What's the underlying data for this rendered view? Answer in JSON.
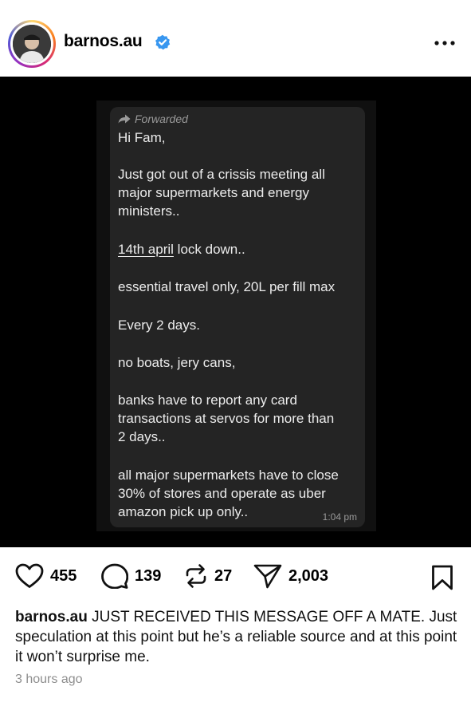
{
  "header": {
    "username": "barnos.au",
    "verified": true,
    "more_icon": "more-horizontal-icon",
    "avatar_ring_colors": [
      "#feda75",
      "#fa7e1e",
      "#d62976",
      "#962fbf",
      "#4f5bd5"
    ]
  },
  "message": {
    "forwarded_label": "Forwarded",
    "lines": [
      "Hi Fam,",
      "",
      "Just got out of a crissis meeting all",
      "major supermarkets and energy",
      "ministers..",
      "",
      "14th april lock down..",
      "",
      "essential travel only, 20L per fill max",
      "",
      "Every 2 days.",
      "",
      "no boats, jery cans,",
      "",
      "banks have to report any card",
      "transactions at servos for more than",
      "2 days..",
      "",
      "all major supermarkets have to close",
      "30% of stores and operate as uber",
      "amazon pick up only.."
    ],
    "underlined_text": "14th april",
    "after_underline": " lock down..",
    "time": "1:04 pm"
  },
  "actions": {
    "likes": "455",
    "comments": "139",
    "reposts": "27",
    "shares": "2,003"
  },
  "caption": {
    "username": "barnos.au",
    "text": " JUST RECEIVED THIS MESSAGE OFF A MATE. Just speculation at this point but he’s a reliable source and at this point it won’t surprise me."
  },
  "time_ago": "3 hours ago",
  "colors": {
    "verified_blue": "#3897f0",
    "bubble": "#242424",
    "media_bg": "#000000",
    "muted_text": "#8e8e8e"
  }
}
